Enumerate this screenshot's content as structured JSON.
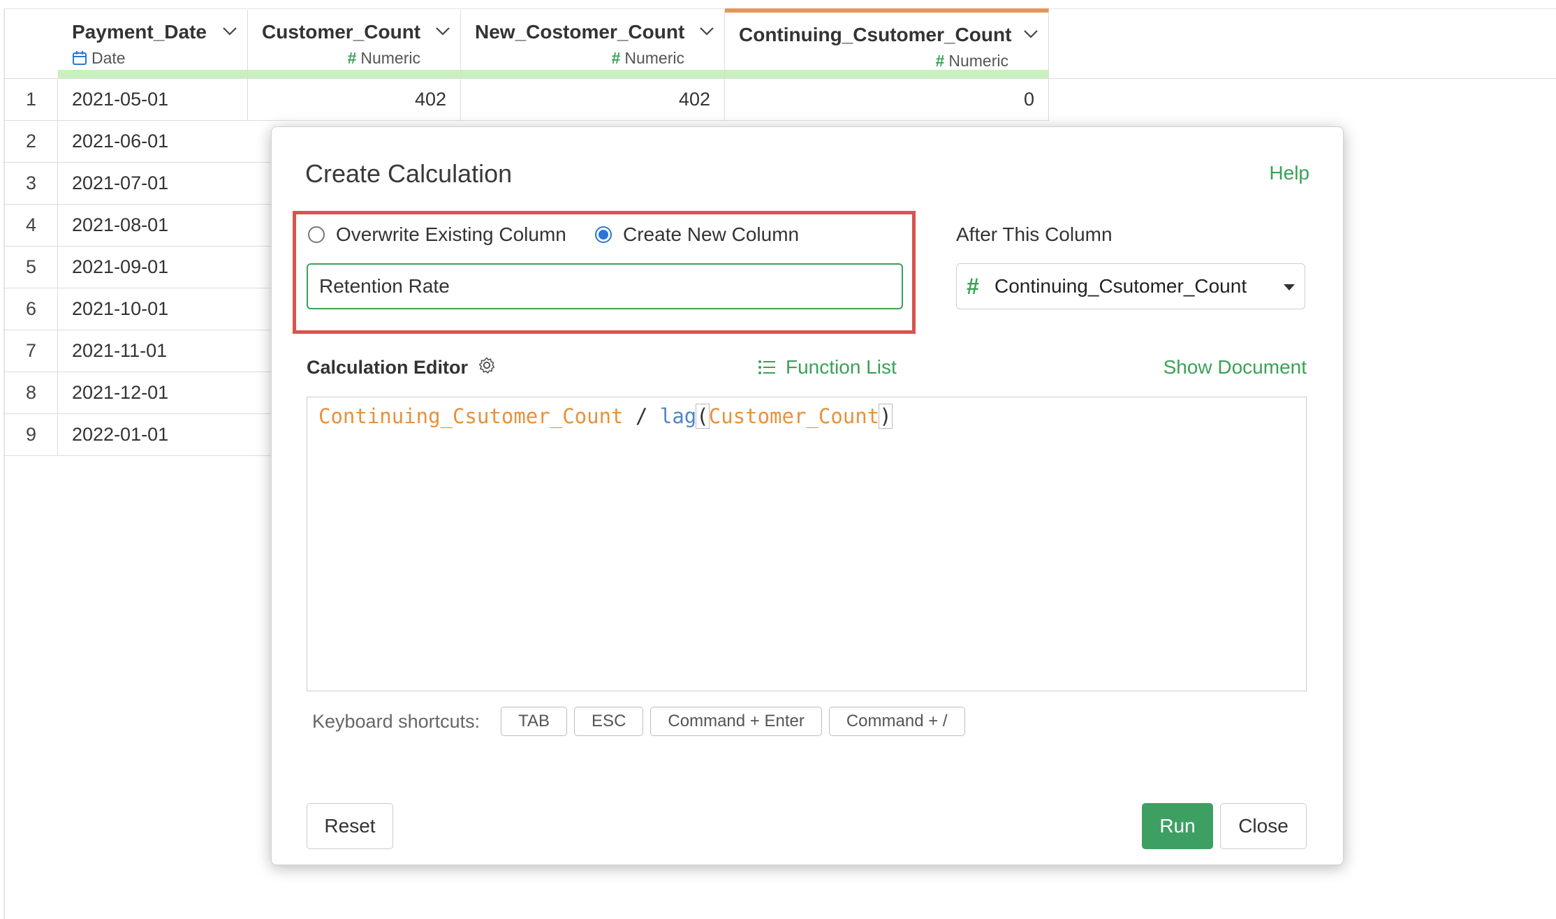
{
  "table": {
    "columns": [
      {
        "name": "Payment_Date",
        "type": "Date",
        "type_icon": "calendar-icon"
      },
      {
        "name": "Customer_Count",
        "type": "Numeric",
        "type_icon": "hash-icon"
      },
      {
        "name": "New_Costomer_Count",
        "type": "Numeric",
        "type_icon": "hash-icon"
      },
      {
        "name": "Continuing_Csutomer_Count",
        "type": "Numeric",
        "type_icon": "hash-icon"
      }
    ],
    "rows": [
      {
        "index": "1",
        "date": "2021-05-01",
        "customer_count": "402",
        "new_customer_count": "402",
        "continuing_count": "0"
      },
      {
        "index": "2",
        "date": "2021-06-01"
      },
      {
        "index": "3",
        "date": "2021-07-01"
      },
      {
        "index": "4",
        "date": "2021-08-01"
      },
      {
        "index": "5",
        "date": "2021-09-01"
      },
      {
        "index": "6",
        "date": "2021-10-01"
      },
      {
        "index": "7",
        "date": "2021-11-01"
      },
      {
        "index": "8",
        "date": "2021-12-01"
      },
      {
        "index": "9",
        "date": "2022-01-01"
      }
    ],
    "accent_color": "#e3965a",
    "quality_bar_color": "#c8f1bf"
  },
  "dialog": {
    "title": "Create Calculation",
    "help_label": "Help",
    "mode": {
      "overwrite_label": "Overwrite Existing Column",
      "create_label": "Create New Column",
      "selected": "create"
    },
    "new_column_name": "Retention Rate",
    "after_column": {
      "label": "After This Column",
      "value": "Continuing_Csutomer_Count",
      "type_icon": "hash-icon"
    },
    "editor": {
      "label": "Calculation Editor",
      "function_list_label": "Function List",
      "show_document_label": "Show Document",
      "tokens": {
        "t1": "Continuing_Csutomer_Count",
        "t2": " / ",
        "t3": "lag",
        "t4": "(",
        "t5": "Customer_Count",
        "t6": ")"
      }
    },
    "shortcuts": {
      "label": "Keyboard shortcuts:",
      "keys": [
        "TAB",
        "ESC",
        "Command + Enter",
        "Command + /"
      ]
    },
    "buttons": {
      "reset": "Reset",
      "run": "Run",
      "close": "Close"
    },
    "colors": {
      "green": "#3aa156",
      "highlight_red": "#d9534f",
      "column_token": "#e8913b",
      "function_token": "#4f86c6",
      "radio_blue": "#2a76d6"
    }
  }
}
